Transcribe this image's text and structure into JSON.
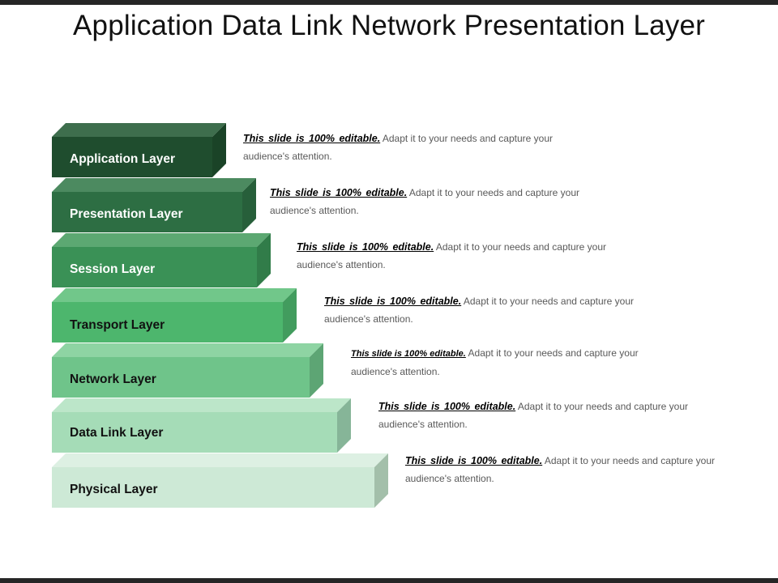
{
  "title": "Application Data Link Network Presentation Layer",
  "layers": [
    {
      "label": "Application Layer",
      "front": "#1f4d2e",
      "top": "#3e6e4d",
      "side": "#1a4327",
      "text_color": "#ffffff",
      "desc_em": "This slide is 100% editable.",
      "desc_text": " Adapt it to your needs and capture your audience's attention."
    },
    {
      "label": "Presentation Layer",
      "front": "#2d6e43",
      "top": "#4c8a60",
      "side": "#275f3a",
      "text_color": "#ffffff",
      "desc_em": "This slide is 100% editable.",
      "desc_text": " Adapt it to your needs and capture your audience's attention."
    },
    {
      "label": "Session Layer",
      "front": "#3a9156",
      "top": "#5ca872",
      "side": "#317c49",
      "text_color": "#ffffff",
      "desc_em": "This slide is 100% editable.",
      "desc_text": " Adapt it to your needs and capture your audience's attention."
    },
    {
      "label": "Transport Layer",
      "front": "#4db66d",
      "top": "#71c78a",
      "side": "#429c5e",
      "text_color": "#111111",
      "desc_em": "This slide is 100% editable.",
      "desc_text": " Adapt it to your needs and capture your audience's attention."
    },
    {
      "label": "Network Layer",
      "front": "#6fc48a",
      "top": "#8ed4a3",
      "side": "#5da574",
      "text_color": "#111111",
      "desc_em": "This slide is 100% editable.",
      "desc_text": " Adapt it to your needs and capture your audience's attention."
    },
    {
      "label": "Data Link Layer",
      "front": "#a5dcb7",
      "top": "#bce6c9",
      "side": "#86b598",
      "text_color": "#111111",
      "desc_em": "This slide is 100% editable.",
      "desc_text": " Adapt it to your needs and capture your audience's attention."
    },
    {
      "label": "Physical Layer",
      "front": "#cde9d6",
      "top": "#ddf0e3",
      "side": "#a3bfaa",
      "text_color": "#111111",
      "desc_em": "This slide is 100% editable.",
      "desc_text": " Adapt it to your needs and capture your audience's attention."
    }
  ]
}
